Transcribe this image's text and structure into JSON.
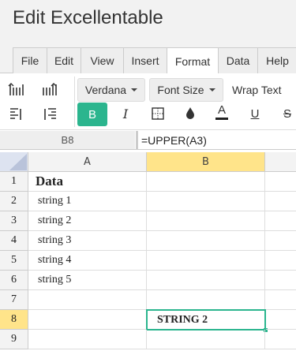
{
  "app": {
    "title": "Edit Excellentable"
  },
  "menu_tabs": [
    "File",
    "Edit",
    "View",
    "Insert",
    "Format",
    "Data",
    "Help"
  ],
  "active_tab": "Format",
  "toolbar": {
    "font_family": "Verdana",
    "font_size": "Font Size",
    "wrap_text": "Wrap Text",
    "bold": "B",
    "italic": "I",
    "text_color": "A",
    "underline": "U",
    "strikethrough": "S"
  },
  "formula_bar": {
    "cell_ref": "B8",
    "formula": "=UPPER(A3)"
  },
  "columns": [
    "A",
    "B"
  ],
  "rows": [
    {
      "num": "1",
      "a": "Data",
      "b": ""
    },
    {
      "num": "2",
      "a": "string 1",
      "b": ""
    },
    {
      "num": "3",
      "a": "string 2",
      "b": ""
    },
    {
      "num": "4",
      "a": "string 3",
      "b": ""
    },
    {
      "num": "5",
      "a": "string 4",
      "b": ""
    },
    {
      "num": "6",
      "a": "string 5",
      "b": ""
    },
    {
      "num": "7",
      "a": "",
      "b": ""
    },
    {
      "num": "8",
      "a": "",
      "b": "STRING 2"
    },
    {
      "num": "9",
      "a": "",
      "b": ""
    }
  ],
  "selected_cell": {
    "column": "B",
    "row": "8"
  },
  "colors": {
    "accent": "#2bb58e",
    "selection": "#ffe48a"
  }
}
